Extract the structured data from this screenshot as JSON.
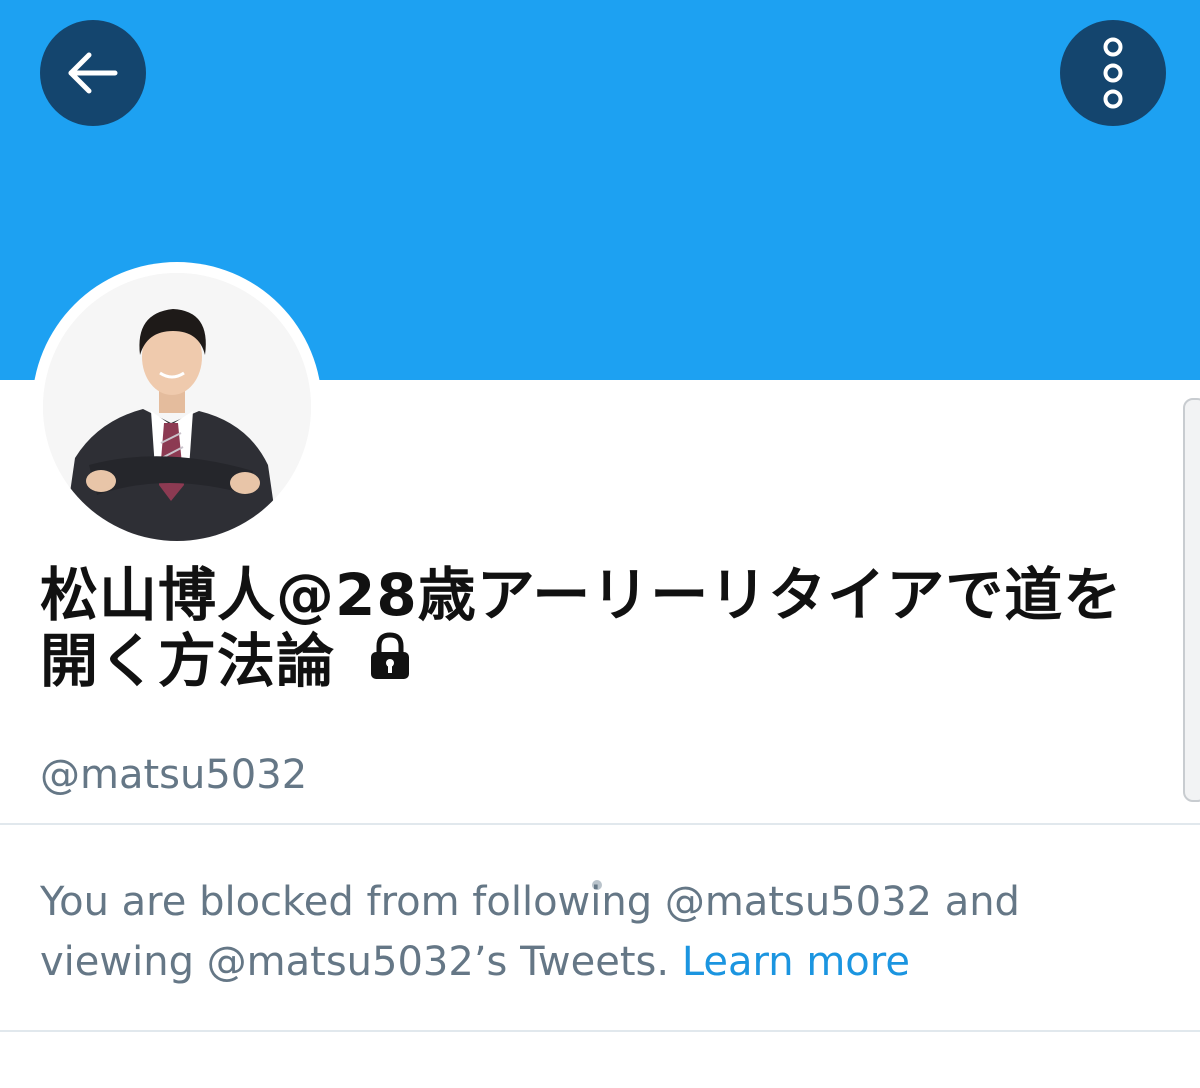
{
  "header": {
    "back_icon": "arrow-left-icon",
    "more_icon": "more-vertical-icon",
    "banner_color": "#1da1f2",
    "button_color": "#14456e"
  },
  "profile": {
    "display_name": "松山博人@28歳アーリーリタイアで道を開く方法論",
    "protected_icon": "lock-icon",
    "handle": "@matsu5032"
  },
  "notice": {
    "message": "You are blocked from following @matsu5032 and viewing @matsu5032’s Tweets.",
    "link_label": "Learn more",
    "link_color": "#1b95e0"
  }
}
